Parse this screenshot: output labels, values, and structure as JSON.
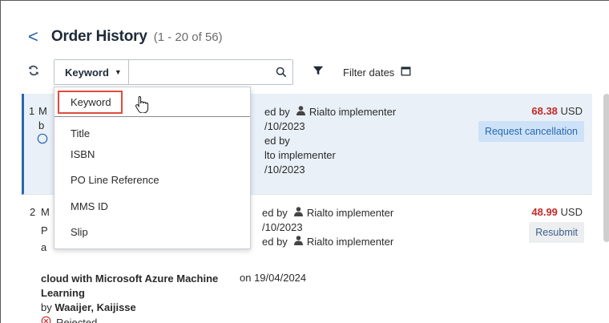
{
  "header": {
    "back_glyph": "<",
    "title": "Order History",
    "count": "(1 - 20 of 56)"
  },
  "toolbar": {
    "refresh_icon": "refresh-icon",
    "keyword_label": "Keyword",
    "search_value": "",
    "search_placeholder": "",
    "filter_dates_label": "Filter dates"
  },
  "dropdown": {
    "options": [
      "Keyword",
      "Title",
      "ISBN",
      "PO Line Reference",
      "MMS ID",
      "Slip"
    ],
    "selected": "Keyword"
  },
  "orders": [
    {
      "number": "1",
      "fragments": [
        "M",
        "b"
      ],
      "ordered_by_prefix": "ed by",
      "ordered_by_name": "Rialto implementer",
      "date1": "/10/2023",
      "updated_by_prefix": "ed by",
      "updated_by_name": "lto implementer",
      "date2": "/10/2023",
      "price": "68.38",
      "currency": "USD",
      "action": "Request cancellation"
    },
    {
      "number": "2",
      "fragments": [
        "M",
        "P",
        "a"
      ],
      "title_line1": "cloud with Microsoft Azure Machine",
      "title_line2": "Learning",
      "by_prefix": "by",
      "authors": "Waaijer, Kaijisse",
      "status": "Rejected",
      "ordered_by_prefix": "ed by",
      "ordered_by_name": "Rialto implementer",
      "date1": "/10/2023",
      "updated_by_prefix": "ed by",
      "updated_by_name": "Rialto implementer",
      "on_date": "on 19/04/2024",
      "price": "48.99",
      "currency": "USD",
      "action": "Resubmit"
    }
  ],
  "colors": {
    "accent": "#2a68b1",
    "price": "#c22b2b",
    "highlight_row": "#e9f0f7",
    "selected_outline": "#e04b3c"
  }
}
